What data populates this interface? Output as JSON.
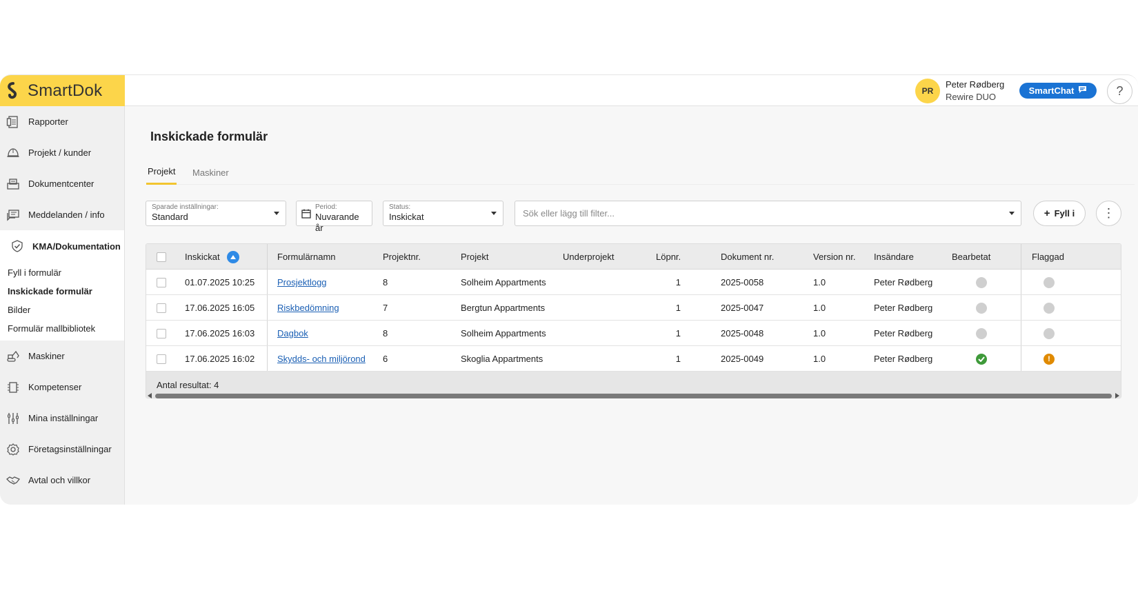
{
  "brand": {
    "name": "SmartDok",
    "color": "#fcd54a"
  },
  "user": {
    "initials": "PR",
    "name": "Peter Rødberg",
    "company": "Rewire DUO"
  },
  "header": {
    "smartchat_label": "SmartChat",
    "help_label": "?"
  },
  "sidebar": {
    "items": [
      {
        "label": "Rapporter",
        "icon": "report-icon"
      },
      {
        "label": "Projekt / kunder",
        "icon": "helmet-icon"
      },
      {
        "label": "Dokumentcenter",
        "icon": "document-box-icon"
      },
      {
        "label": "Meddelanden / info",
        "icon": "message-icon"
      },
      {
        "label": "KMA/Dokumentation",
        "icon": "shield-check-icon"
      },
      {
        "label": "Maskiner",
        "icon": "excavator-icon"
      },
      {
        "label": "Kompetenser",
        "icon": "competence-icon"
      },
      {
        "label": "Mina inställningar",
        "icon": "sliders-icon"
      },
      {
        "label": "Företagsinställningar",
        "icon": "gear-icon"
      },
      {
        "label": "Avtal och villkor",
        "icon": "handshake-icon"
      }
    ],
    "subitems": [
      {
        "label": "Fyll i formulär"
      },
      {
        "label": "Inskickade formulär"
      },
      {
        "label": "Bilder"
      },
      {
        "label": "Formulär mallbibliotek"
      }
    ]
  },
  "main": {
    "title": "Inskickade formulär",
    "tabs": [
      {
        "label": "Projekt"
      },
      {
        "label": "Maskiner"
      }
    ],
    "filters": {
      "saved": {
        "label": "Sparade inställningar:",
        "value": "Standard"
      },
      "period": {
        "label": "Period:",
        "value": "Nuvarande år"
      },
      "status": {
        "label": "Status:",
        "value": "Inskickat"
      },
      "search_placeholder": "Sök eller lägg till filter...",
      "fill_label": "Fyll i",
      "more_label": "⋮"
    },
    "table": {
      "columns": [
        "Inskickat",
        "Formulärnamn",
        "Projektnr.",
        "Projekt",
        "Underprojekt",
        "Löpnr.",
        "Dokument nr.",
        "Version nr.",
        "Insändare",
        "Bearbetat",
        "Flaggad"
      ],
      "rows": [
        {
          "inskickat": "01.07.2025 10:25",
          "formular": "Prosjektlogg",
          "projektnr": "8",
          "projekt": "Solheim Appartments",
          "underprojekt": "",
          "lopnr": "1",
          "dokument": "2025-0058",
          "version": "1.0",
          "insandare": "Peter Rødberg",
          "bearbetat": "none",
          "flaggad": "none"
        },
        {
          "inskickat": "17.06.2025 16:05",
          "formular": "Riskbedömning",
          "projektnr": "7",
          "projekt": "Bergtun Appartments",
          "underprojekt": "",
          "lopnr": "1",
          "dokument": "2025-0047",
          "version": "1.0",
          "insandare": "Peter Rødberg",
          "bearbetat": "none",
          "flaggad": "none"
        },
        {
          "inskickat": "17.06.2025 16:03",
          "formular": "Dagbok",
          "projektnr": "8",
          "projekt": "Solheim Appartments",
          "underprojekt": "",
          "lopnr": "1",
          "dokument": "2025-0048",
          "version": "1.0",
          "insandare": "Peter Rødberg",
          "bearbetat": "none",
          "flaggad": "none"
        },
        {
          "inskickat": "17.06.2025 16:02",
          "formular": "Skydds- och miljörond",
          "projektnr": "6",
          "projekt": "Skoglia Appartments",
          "underprojekt": "",
          "lopnr": "1",
          "dokument": "2025-0049",
          "version": "1.0",
          "insandare": "Peter Rødberg",
          "bearbetat": "done",
          "flaggad": "flagged"
        }
      ],
      "footer": "Antal resultat: 4"
    },
    "status_colors": {
      "none": "#cfcfcf",
      "done": "#3f9a3a",
      "flagged": "#e08a00",
      "sort": "#2e8ae6"
    },
    "flag_symbol": "!"
  }
}
